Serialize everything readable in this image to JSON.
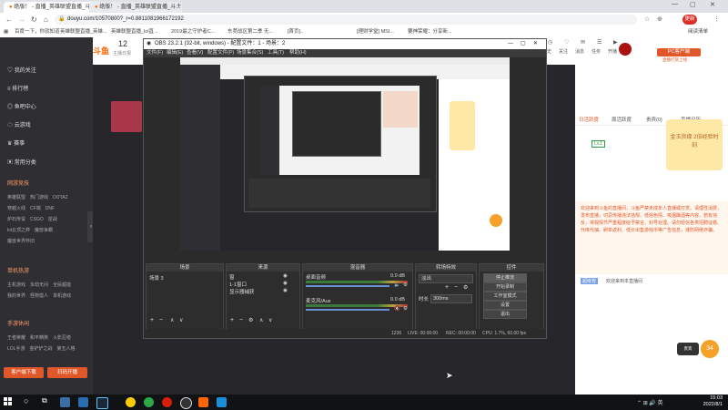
{
  "browser": {
    "tabs": [
      {
        "label": "绝版！ - 直播_英雄联盟直播_斗..."
      },
      {
        "label": "绝版！ - 直播_英雄联盟直播_斗..."
      }
    ],
    "url": "douyu.com/10570800?_r=0.8811081966172192",
    "upgrade_label": "更新",
    "bookmarks": [
      "百度一下，你就知道",
      "英雄联盟直播_英雄...",
      "英雄联盟直播_lol直...",
      "2019最之守护者C...",
      "东莞战区第二季 无...",
      "[首页]..",
      "[理财学堂] MSI...",
      "要神荣耀：分享新..."
    ],
    "reading_list": "阅读清单"
  },
  "douyu": {
    "logo": "斗鱼",
    "sidebar": {
      "items": [
        "我的关注",
        "排行榜",
        "鱼吧中心",
        "云游戏",
        "赛事",
        "常用分类",
        "网游竞技",
        "单机热游",
        "手游休闲"
      ],
      "grid_top": [
        "英雄联盟",
        "热门游戏",
        "DOTA2",
        "穿越火线",
        "CF端",
        "DNF",
        "炉石传说",
        "CSGO",
        "逆战",
        "lol云顶之弈",
        "魔兽争霸",
        "魔兽世界怀旧"
      ],
      "grid_mid": [
        "主机游戏",
        "永劫无间",
        "全民超能",
        "我的世界",
        "怪物猎人",
        "单机游戏"
      ],
      "grid_bottom": [
        "王者荣耀",
        "和平精英",
        "火影忍者",
        "LOL手游",
        "金铲铲之战",
        "第五人格"
      ],
      "bottom_left": "客户端下载",
      "bottom_right": "扫码开播"
    },
    "header": {
      "count": "12",
      "count_label": "主播日报",
      "nav": [
        "历史",
        "关注",
        "消息",
        "任务",
        "开播"
      ],
      "pc_label": "PC客户端",
      "pc_sub": "直播打赏上线",
      "upload_label": "直播上传",
      "more_label": "更多"
    },
    "right": {
      "tabs": [
        "日活跃度",
        "周活跃度",
        "贵宾(0)",
        "直播日历"
      ],
      "badge": "Lv.1",
      "event_text": "金玉良缘 2倍经验时刻",
      "notice": "欢迎来到斗鱼的直播间，斗鱼严禁未成年人直播或打赏。请理性消费，发布直播，切忌传播违法违规、低俗色情、吸烟酗酒等内容，若有违反，将视情节严重程度给予禁言、封号处理。请勿轻信各类招聘征婚、代练代抽、刷单返利、低价出售游戏币等广告信息，谨防网络诈骗。",
      "welcome": "欢迎来到本直播间",
      "welcome_tag": "超级管",
      "badge_count": "34",
      "rank_label": "贵宾"
    }
  },
  "obs": {
    "title": "OBS 23.2.1 (32-bit, windows) - 配置文件：1 - 场景：2",
    "menu": [
      "文件(F)",
      "编辑(E)",
      "查看(V)",
      "配置文件(P)",
      "场景集合(S)",
      "工具(T)",
      "帮助(H)"
    ],
    "docks": {
      "scenes": {
        "title": "场景",
        "items": [
          "场景 3"
        ]
      },
      "sources": {
        "title": "来源",
        "items": [
          "窗",
          "1-1窗口",
          "显示器捕获"
        ]
      },
      "mixer": {
        "title": "混音器",
        "ch1": "桌面音频",
        "ch1_db": "0.0 dB",
        "ch2": "麦克风/Aux",
        "ch2_db": "0.0 dB"
      },
      "transitions": {
        "title": "转场特效",
        "type": "淡出",
        "duration_label": "时长",
        "duration": "300ms"
      },
      "controls": {
        "title": "控件",
        "buttons": [
          "停止推流",
          "开始录制",
          "工作室模式",
          "设置",
          "退出"
        ]
      }
    },
    "status": {
      "live": "LIVE: 00:00:00",
      "rec": "REC: 00:00:00",
      "cpu": "CPU: 1.7%, 60.00 fps",
      "dropped": "1236"
    }
  },
  "taskbar": {
    "time": "15:03",
    "date": "2022/8/1",
    "apps": [
      "search-icon",
      "task-view-icon",
      "file-explorer-icon",
      "edge-icon",
      "steam-icon",
      "chrome-icon",
      "green-app-icon",
      "netease-icon",
      "obs-icon",
      "douyu-icon",
      "blue-app-icon"
    ]
  }
}
